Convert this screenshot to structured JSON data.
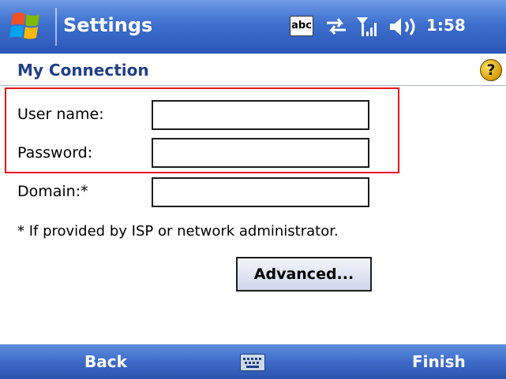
{
  "titlebar": {
    "app_title": "Settings",
    "status_input_indicator": "abc",
    "clock": "1:58",
    "icons": [
      "windows-start-icon",
      "connectivity-arrows-icon",
      "signal-strength-icon",
      "speaker-icon"
    ]
  },
  "header": {
    "title": "My Connection",
    "help_icon": "?"
  },
  "form": {
    "user_name_label": "User name:",
    "user_name_value": "",
    "password_label": "Password:",
    "password_value": "",
    "domain_label": "Domain:*",
    "domain_value": "",
    "note": "* If provided by ISP or network administrator.",
    "advanced_button": "Advanced..."
  },
  "softbar": {
    "left": "Back",
    "right": "Finish",
    "keyboard_icon": "keyboard-icon"
  },
  "colors": {
    "titlebar": "#3d6fcf",
    "header_text": "#1f3f86",
    "highlight": "#e8151b"
  }
}
